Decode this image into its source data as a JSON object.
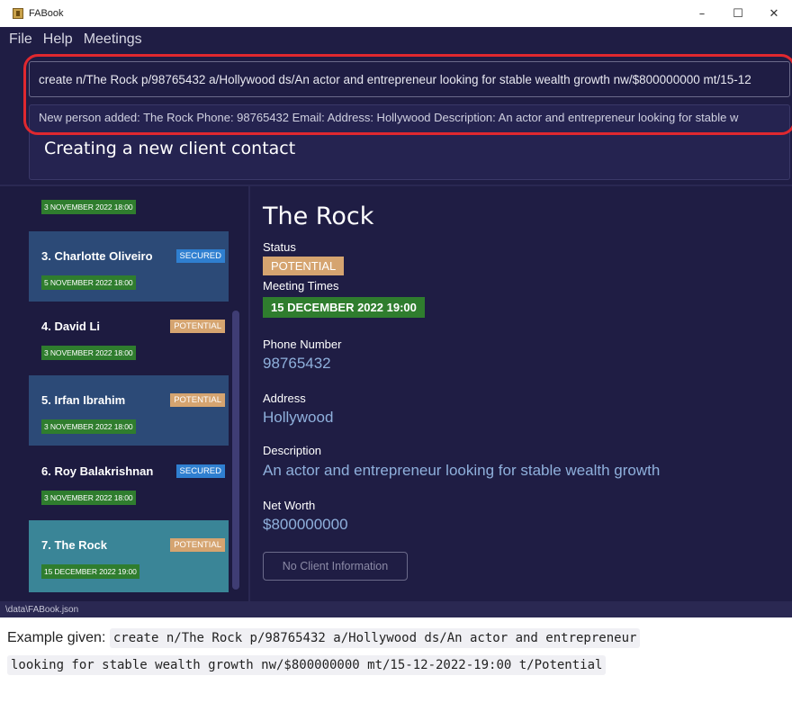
{
  "window": {
    "title": "FABook",
    "controls": {
      "minimize": "–",
      "maximize": "☐",
      "close": "✕"
    }
  },
  "menu": [
    "File",
    "Help",
    "Meetings"
  ],
  "command": {
    "input": "create n/The Rock p/98765432 a/Hollywood ds/An actor and entrepreneur looking for stable wealth growth nw/$800000000 mt/15-12"
  },
  "result": {
    "message": "New person added: The Rock Phone: 98765432 Email:  Address: Hollywood Description: An actor and entrepreneur looking for stable w",
    "heading": "Creating a new client contact"
  },
  "list": {
    "partial_time": "3 NOVEMBER 2022 18:00",
    "items": [
      {
        "name": "3.  Charlotte Oliveiro",
        "tag": "SECURED",
        "time": "5 NOVEMBER 2022 18:00",
        "bg": "#2c4a77"
      },
      {
        "name": "4.  David Li",
        "tag": "POTENTIAL",
        "time": "3 NOVEMBER 2022 18:00",
        "bg": "#1d1b40"
      },
      {
        "name": "5.  Irfan Ibrahim",
        "tag": "POTENTIAL",
        "time": "3 NOVEMBER 2022 18:00",
        "bg": "#2c4a77"
      },
      {
        "name": "6.  Roy Balakrishnan",
        "tag": "SECURED",
        "time": "3 NOVEMBER 2022 18:00",
        "bg": "#1d1b40"
      },
      {
        "name": "7.  The Rock",
        "tag": "POTENTIAL",
        "time": "15 DECEMBER 2022 19:00",
        "bg": "#3a8597"
      }
    ]
  },
  "detail": {
    "name": "The Rock",
    "status_label": "Status",
    "status": "POTENTIAL",
    "meeting_label": "Meeting Times",
    "meeting": "15 DECEMBER 2022 19:00",
    "phone_label": "Phone Number",
    "phone": "98765432",
    "address_label": "Address",
    "address": "Hollywood",
    "description_label": "Description",
    "description": "An actor and entrepreneur looking for stable wealth growth",
    "networth_label": "Net Worth",
    "networth": "$800000000",
    "button": "No Client Information"
  },
  "statusbar": {
    "path": "\\data\\FABook.json"
  },
  "caption": {
    "prefix": "Example given:",
    "code_line1": "create n/The Rock p/98765432 a/Hollywood ds/An actor and entrepreneur",
    "code_line2": "looking for stable wealth growth nw/$800000000 mt/15-12-2022-19:00 t/Potential"
  },
  "colors": {
    "background": "#1f1d44",
    "highlight": "#e0282f",
    "secured": "#2f7fd0",
    "potential": "#d5a470",
    "meeting": "#2f7d2e"
  }
}
